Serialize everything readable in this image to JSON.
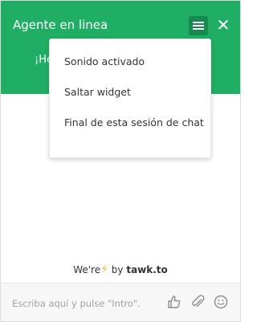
{
  "header": {
    "title": "Agente en linea",
    "greeting_partial": "¡He",
    "background_color": "#1fae63",
    "menu_icon": "hamburger-menu-icon",
    "close_icon": "close-icon",
    "close_glyph": "✕"
  },
  "menu": {
    "items": [
      {
        "label": "Sonido activado"
      },
      {
        "label": "Saltar widget"
      },
      {
        "label": "Final de esta sesión de chat"
      }
    ]
  },
  "branding": {
    "prefix": "We're",
    "bolt": "⚡",
    "by": "by",
    "brand": "tawk.to"
  },
  "composer": {
    "placeholder": "Escriba aquí y pulse \"Intro\".",
    "icons": [
      "thumbs-up-icon",
      "paperclip-icon",
      "emoji-icon"
    ]
  }
}
